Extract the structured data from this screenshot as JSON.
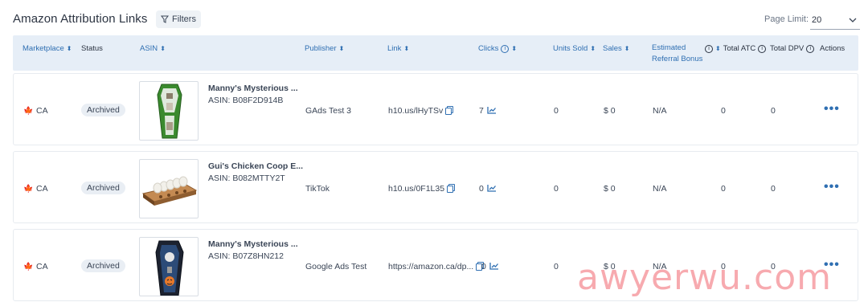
{
  "header": {
    "title": "Amazon Attribution Links",
    "filters_label": "Filters",
    "page_limit_label": "Page Limit:",
    "page_limit_value": "20"
  },
  "columns": {
    "marketplace": "Marketplace",
    "status": "Status",
    "asin": "ASIN",
    "publisher": "Publisher",
    "link": "Link",
    "clicks": "Clicks",
    "units_sold": "Units Sold",
    "sales": "Sales",
    "estimated_1": "Estimated",
    "estimated_2": "Referral Bonus",
    "total_atc": "Total ATC",
    "total_dpv": "Total DPV",
    "actions": "Actions"
  },
  "rows": [
    {
      "marketplace": "CA",
      "status": "Archived",
      "product_name": "Manny's Mysterious ...",
      "asin": "ASIN: B08F2D914B",
      "publisher": "GAds Test 3",
      "link": "h10.us/lHyTSv",
      "clicks": "7",
      "units_sold": "0",
      "sales": "$ 0",
      "referral_bonus": "N/A",
      "total_atc": "0",
      "total_dpv": "0",
      "actions": "•••"
    },
    {
      "marketplace": "CA",
      "status": "Archived",
      "product_name": "Gui's Chicken Coop E...",
      "asin": "ASIN: B082MTTY2T",
      "publisher": "TikTok",
      "link": "h10.us/0F1L35",
      "clicks": "0",
      "units_sold": "0",
      "sales": "$ 0",
      "referral_bonus": "N/A",
      "total_atc": "0",
      "total_dpv": "0",
      "actions": "•••"
    },
    {
      "marketplace": "CA",
      "status": "Archived",
      "product_name": "Manny's Mysterious ...",
      "asin": "ASIN: B07Z8HN212",
      "publisher": "Google Ads Test",
      "link": "https://amazon.ca/dp...",
      "clicks": "0",
      "units_sold": "0",
      "sales": "$ 0",
      "referral_bonus": "N/A",
      "total_atc": "0",
      "total_dpv": "0",
      "actions": "•••"
    }
  ],
  "watermark": "awyerwu.com",
  "colors": {
    "accent": "#2f6fb2",
    "header_bg": "#e6eef7",
    "flag_red": "#d0021b"
  }
}
